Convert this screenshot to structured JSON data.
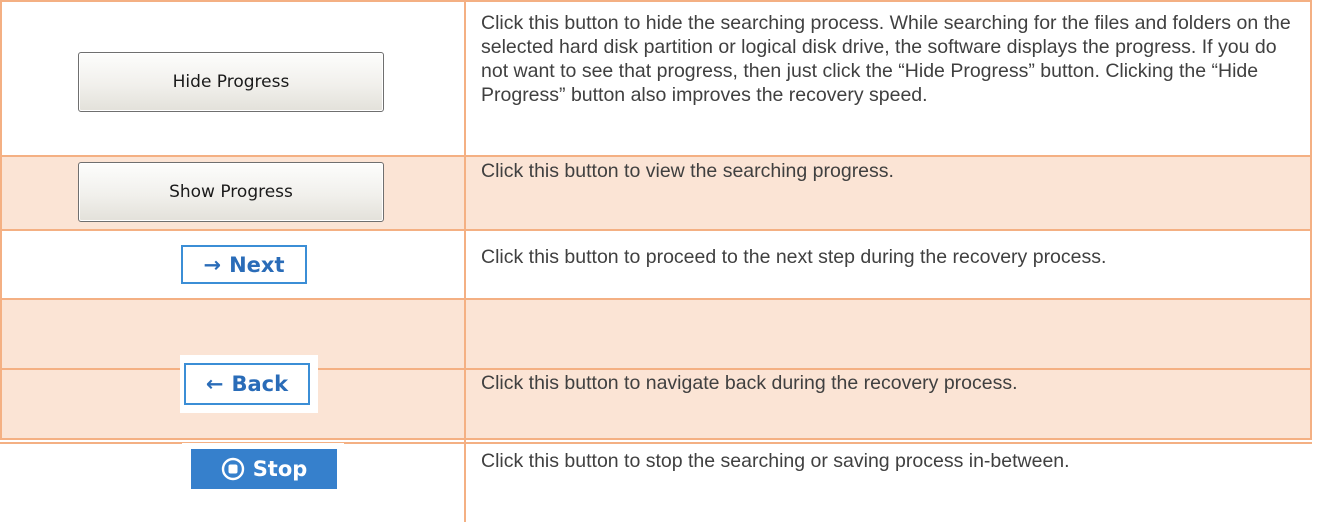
{
  "rows": [
    {
      "button": {
        "label": "Hide Progress",
        "icon": ""
      },
      "description": "Click this button to hide the searching process. While searching for the files and folders on the selected hard disk partition or logical disk drive, the software displays the progress. If you do not want to see that progress, then just click the “Hide Progress” button. Clicking the “Hide Progress” button also improves the recovery speed."
    },
    {
      "button": {
        "label": "Show Progress",
        "icon": ""
      },
      "description": "Click this button to view the searching progress."
    },
    {
      "button": {
        "label": "Next",
        "icon": "→"
      },
      "description": "Click this button to proceed to the next step during the recovery process."
    },
    {
      "button": {
        "label": "Back",
        "icon": "←"
      },
      "description": "Click this button to navigate back during the recovery process."
    },
    {
      "button": {
        "label": "Stop",
        "icon": "stop-icon"
      },
      "description": "Click this button to stop the searching or saving process in-between."
    }
  ],
  "colors": {
    "border": "#f4b083",
    "shaded_row": "#fbe4d5",
    "accent_blue": "#3680cc",
    "text": "#404040"
  }
}
